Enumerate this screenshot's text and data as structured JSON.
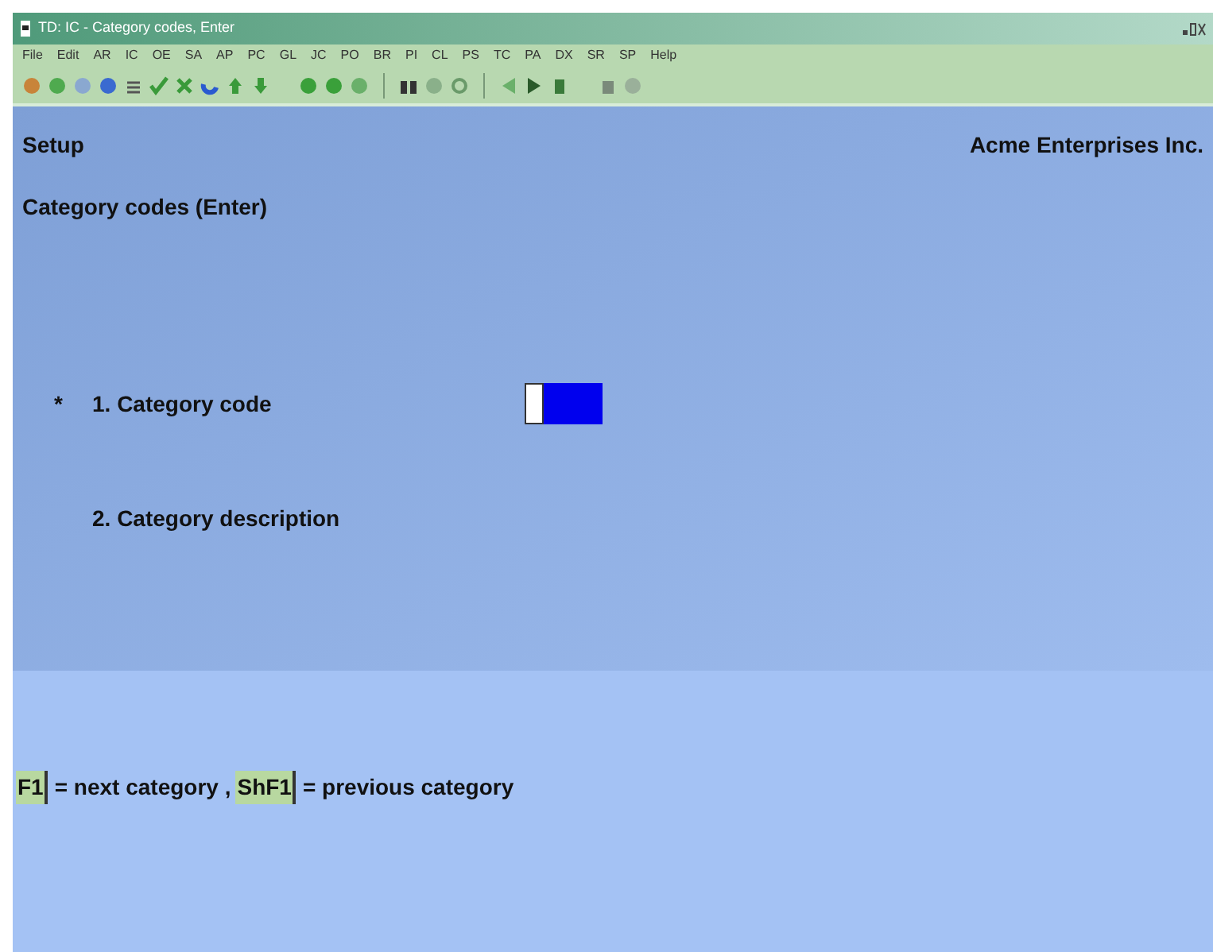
{
  "window": {
    "title": "TD: IC - Category codes, Enter"
  },
  "menu": [
    "File",
    "Edit",
    "AR",
    "IC",
    "OE",
    "SA",
    "AP",
    "PC",
    "GL",
    "JC",
    "PO",
    "BR",
    "PI",
    "CL",
    "PS",
    "TC",
    "PA",
    "DX",
    "SR",
    "SP",
    "Help"
  ],
  "header": {
    "left": "Setup",
    "right": "Acme Enterprises Inc.",
    "subtitle": "Category codes (Enter)"
  },
  "fields": [
    {
      "marker": "*",
      "label": "1. Category code",
      "focused": true
    },
    {
      "label": "2. Category description",
      "focused": false
    }
  ],
  "footer": [
    {
      "key": "F1",
      "text": "= next category ,"
    },
    {
      "key": "ShF1",
      "text": "= previous category"
    }
  ]
}
